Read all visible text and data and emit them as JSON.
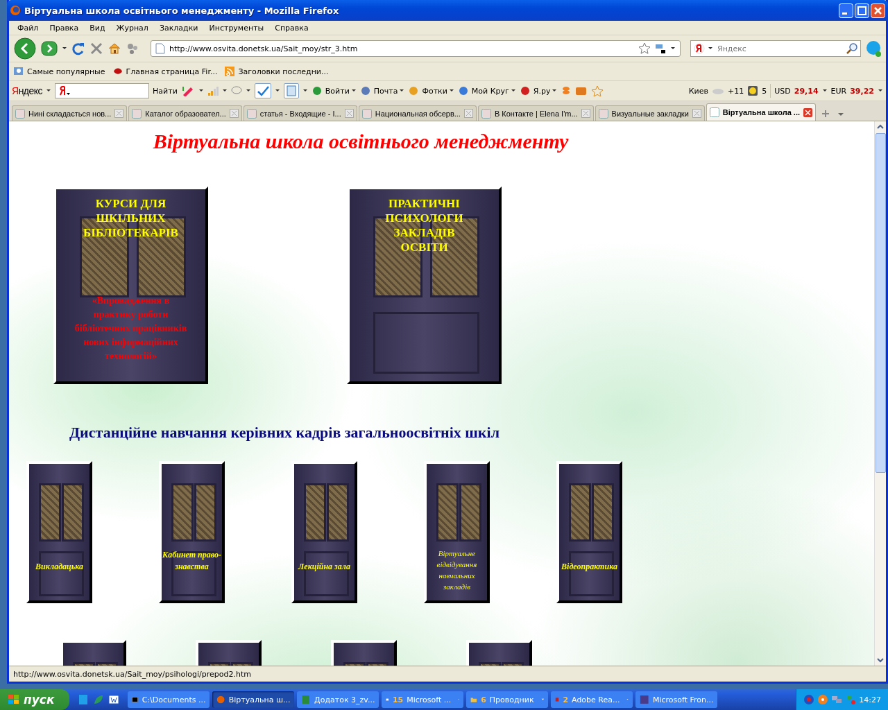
{
  "window": {
    "title": "Віртуальна школа освітнього менеджменту - Mozilla Firefox"
  },
  "menu": [
    "Файл",
    "Правка",
    "Вид",
    "Журнал",
    "Закладки",
    "Инструменты",
    "Справка"
  ],
  "nav": {
    "url": "http://www.osvita.donetsk.ua/Sait_moy/str_3.htm",
    "search_placeholder": "Яндекс"
  },
  "bookmarks": [
    "Самые популярные",
    "Главная страница Fir...",
    "Заголовки последни..."
  ],
  "yandex_bar": {
    "logo": "Яндекс",
    "find": "Найти",
    "services": [
      "Войти",
      "Почта",
      "Фотки",
      "Мой Круг",
      "Я.ру"
    ],
    "city": "Киев",
    "temperature": "+11",
    "traffic": "5",
    "usd_label": "USD",
    "usd": "29,14",
    "eur_label": "EUR",
    "eur": "39,22"
  },
  "tabs": [
    {
      "label": "Нині складається нов...",
      "selected": false
    },
    {
      "label": "Каталог образовател...",
      "selected": false
    },
    {
      "label": "статья - Входящие - I...",
      "selected": false
    },
    {
      "label": "Национальная обсерв...",
      "selected": false
    },
    {
      "label": "В Контакте | Elena I'm...",
      "selected": false
    },
    {
      "label": "Визуальные закладки",
      "selected": false
    },
    {
      "label": "Віртуальна школа ...",
      "selected": true
    }
  ],
  "page": {
    "title": "Віртуальна школа освітнього менеджменту",
    "courses": [
      {
        "heading": "КУРСИ ДЛЯ ШКІЛЬНИХ БІБЛІОТЕКАРІВ",
        "caption": "«Впровадження в практику роботи бібліотечних працівників нових інформаційних технологій»"
      },
      {
        "heading": "ПРАКТИЧНІ ПСИХОЛОГИ ЗАКЛАДІВ ОСВІТИ"
      }
    ],
    "section_title": "Дистанційне навчання керівних кадрів загальноосвітніх шкіл",
    "rooms": [
      {
        "label": "Викладацька",
        "kind": "bold"
      },
      {
        "label": "Кабинет право-знавства",
        "kind": "bold"
      },
      {
        "label": "Лекційна зала",
        "kind": "bold"
      },
      {
        "label": "Віртуальне відвідування навчальних закладів",
        "kind": "light"
      },
      {
        "label": "Відеопрактика",
        "kind": "bold"
      }
    ]
  },
  "status_bar": {
    "text": "http://www.osvita.donetsk.ua/Sait_moy/psihologi/prepod2.htm"
  },
  "taskbar": {
    "start": "пуск",
    "items": [
      {
        "label": "C:\\Documents ...",
        "selected": false
      },
      {
        "label": "Віртуальна ш...",
        "selected": true
      },
      {
        "label": "Додаток 3_zv...",
        "selected": false
      },
      {
        "count": "15",
        "label": "Microsoft ...",
        "selected": false
      },
      {
        "count": "6",
        "label": "Проводник",
        "selected": false
      },
      {
        "count": "2",
        "label": "Adobe Rea...",
        "selected": false
      },
      {
        "label": "Microsoft Fron...",
        "selected": false
      }
    ],
    "clock": "14:27"
  }
}
